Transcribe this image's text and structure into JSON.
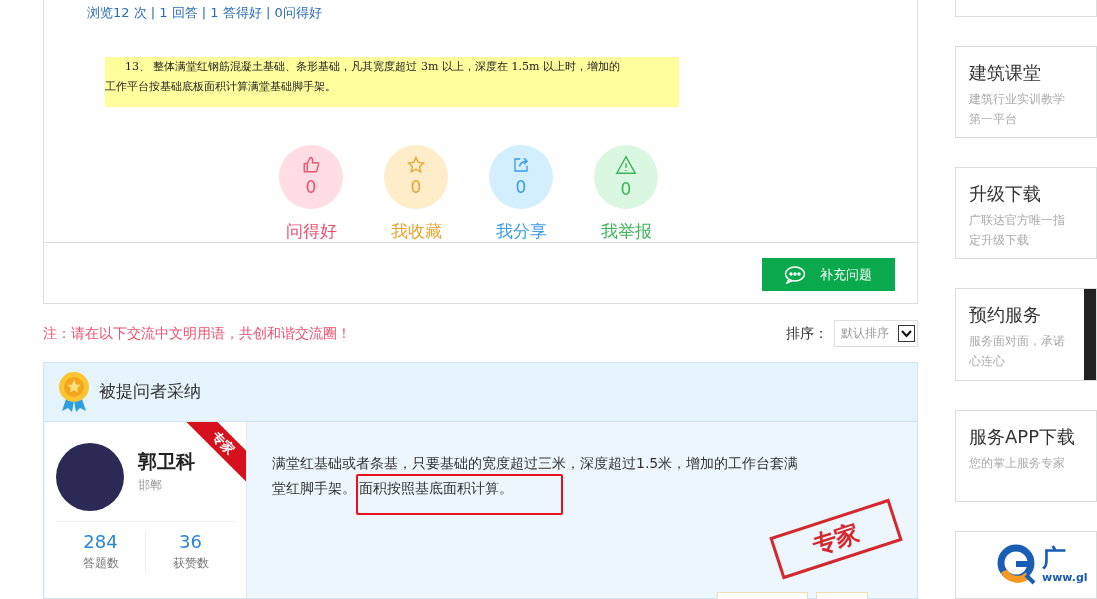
{
  "question": {
    "stats": "浏览12 次 | 1 回答 | 1 答得好 | 0问得好",
    "excerpt_lines": [
      "13、 整体满堂红钢筋混凝土基础、条形基础，凡其宽度超过 3m 以上，深度在 1.5m 以上时，增加的",
      "工作平台按基础底板面积计算满堂基础脚手架。"
    ],
    "actions": [
      {
        "kind": "like",
        "count": "0",
        "label": "问得好"
      },
      {
        "kind": "favorite",
        "count": "0",
        "label": "我收藏"
      },
      {
        "kind": "share",
        "count": "0",
        "label": "我分享"
      },
      {
        "kind": "report",
        "count": "0",
        "label": "我举报"
      }
    ],
    "supplement_button": "补充问题"
  },
  "notice": "注：请在以下交流中文明用语，共创和谐交流圈！",
  "sort": {
    "label": "排序：",
    "value": "默认排序"
  },
  "accepted": {
    "title": "被提问者采纳",
    "ribbon": "专家",
    "user": {
      "name": "郭卫科",
      "location": "邯郸"
    },
    "stats": [
      {
        "value": "284",
        "label": "答题数"
      },
      {
        "value": "36",
        "label": "获赞数"
      }
    ],
    "answer_lines": [
      "满堂红基础或者条基，只要基础的宽度超过三米，深度超过1.5米，增加的工作台套满",
      "堂红脚手架。"
    ],
    "highlighted_text": "面积按照基底面积计算。",
    "stamp": "专家"
  },
  "sidebar": [
    {
      "kind": "text",
      "title": "建筑课堂",
      "subtitle": "建筑行业实训教学第一平台"
    },
    {
      "kind": "text",
      "title": "升级下载",
      "subtitle": "广联达官方唯一指定升级下载"
    },
    {
      "kind": "photo",
      "title": "预约服务",
      "subtitle": "服务面对面，承诺心连心"
    },
    {
      "kind": "text",
      "title": "服务APP下载",
      "subtitle": "您的掌上服务专家"
    },
    {
      "kind": "logo",
      "logo_text": "广",
      "logo_url": "www.gl"
    }
  ]
}
